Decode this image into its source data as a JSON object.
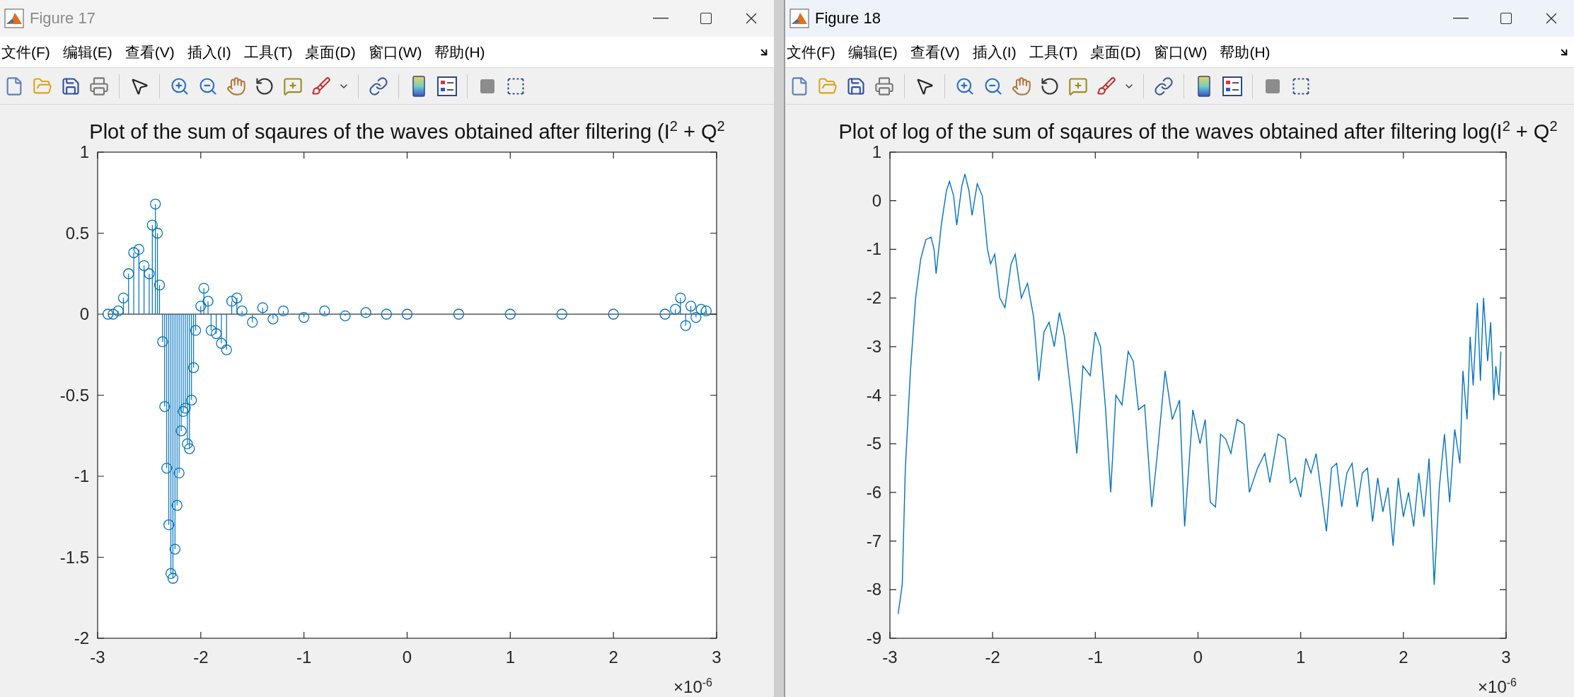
{
  "windows": [
    {
      "title": "Figure 17",
      "active": false,
      "menu": [
        "文件(F)",
        "编辑(E)",
        "查看(V)",
        "插入(I)",
        "工具(T)",
        "桌面(D)",
        "窗口(W)",
        "帮助(H)"
      ],
      "figure": {
        "exponent_label": "×10$^{-6}$",
        "chart_data": {
          "type": "scatter",
          "title": "Plot of the sum of sqaures of the waves obtained after filtering (I$^{2}$ + Q$^{2}$",
          "xlim": [
            -3,
            3
          ],
          "ylim": [
            -2,
            1
          ],
          "xticks": [
            -3,
            -2,
            -1,
            0,
            1,
            2,
            3
          ],
          "yticks": [
            -2,
            -1.5,
            -1,
            -0.5,
            0,
            0.5,
            1
          ],
          "x": [
            -2.9,
            -2.85,
            -2.8,
            -2.75,
            -2.7,
            -2.65,
            -2.6,
            -2.55,
            -2.5,
            -2.47,
            -2.44,
            -2.42,
            -2.4,
            -2.37,
            -2.35,
            -2.33,
            -2.31,
            -2.29,
            -2.27,
            -2.25,
            -2.23,
            -2.21,
            -2.19,
            -2.17,
            -2.15,
            -2.13,
            -2.11,
            -2.09,
            -2.07,
            -2.05,
            -2.0,
            -1.97,
            -1.93,
            -1.9,
            -1.85,
            -1.8,
            -1.75,
            -1.7,
            -1.65,
            -1.6,
            -1.5,
            -1.4,
            -1.3,
            -1.2,
            -1.0,
            -0.8,
            -0.6,
            -0.4,
            -0.2,
            0,
            0.5,
            1,
            1.5,
            2,
            2.5,
            2.6,
            2.65,
            2.7,
            2.75,
            2.8,
            2.85,
            2.9
          ],
          "series": [
            {
              "color": "#0072bd",
              "values": [
                0,
                0,
                0.02,
                0.1,
                0.25,
                0.38,
                0.4,
                0.3,
                0.25,
                0.55,
                0.68,
                0.5,
                0.18,
                -0.17,
                -0.57,
                -0.95,
                -1.3,
                -1.6,
                -1.63,
                -1.45,
                -1.18,
                -0.98,
                -0.72,
                -0.6,
                -0.58,
                -0.8,
                -0.83,
                -0.53,
                -0.33,
                -0.1,
                0.05,
                0.16,
                0.08,
                -0.1,
                -0.12,
                -0.18,
                -0.22,
                0.08,
                0.1,
                0.02,
                -0.05,
                0.04,
                -0.03,
                0.02,
                -0.02,
                0.02,
                -0.01,
                0.01,
                0,
                0,
                0,
                0,
                0,
                0,
                0,
                0.03,
                0.1,
                -0.07,
                0.05,
                -0.02,
                0.03,
                0.02
              ]
            }
          ]
        }
      }
    },
    {
      "title": "Figure 18",
      "active": true,
      "menu": [
        "文件(F)",
        "编辑(E)",
        "查看(V)",
        "插入(I)",
        "工具(T)",
        "桌面(D)",
        "窗口(W)",
        "帮助(H)"
      ],
      "figure": {
        "exponent_label": "×10$^{-6}$",
        "chart_data": {
          "type": "line",
          "title": "Plot of log of the sum of sqaures of the waves obtained after filtering log(I$^{2}$ + Q$^{2}$",
          "xlim": [
            -3,
            3
          ],
          "ylim": [
            -9,
            1
          ],
          "xticks": [
            -3,
            -2,
            -1,
            0,
            1,
            2,
            3
          ],
          "yticks": [
            -9,
            -8,
            -7,
            -6,
            -5,
            -4,
            -3,
            -2,
            -1,
            0,
            1
          ],
          "x": [
            -2.92,
            -2.88,
            -2.85,
            -2.8,
            -2.75,
            -2.7,
            -2.65,
            -2.6,
            -2.57,
            -2.55,
            -2.5,
            -2.45,
            -2.42,
            -2.38,
            -2.35,
            -2.3,
            -2.27,
            -2.23,
            -2.2,
            -2.15,
            -2.1,
            -2.05,
            -2.02,
            -1.98,
            -1.93,
            -1.88,
            -1.82,
            -1.78,
            -1.72,
            -1.66,
            -1.6,
            -1.55,
            -1.5,
            -1.45,
            -1.4,
            -1.35,
            -1.3,
            -1.22,
            -1.18,
            -1.12,
            -1.05,
            -1.0,
            -0.95,
            -0.9,
            -0.85,
            -0.8,
            -0.74,
            -0.68,
            -0.63,
            -0.58,
            -0.52,
            -0.45,
            -0.4,
            -0.32,
            -0.25,
            -0.18,
            -0.13,
            -0.05,
            0.02,
            0.07,
            0.12,
            0.17,
            0.22,
            0.27,
            0.32,
            0.38,
            0.45,
            0.5,
            0.58,
            0.65,
            0.7,
            0.78,
            0.85,
            0.9,
            0.95,
            1.0,
            1.05,
            1.1,
            1.15,
            1.2,
            1.25,
            1.3,
            1.35,
            1.4,
            1.45,
            1.5,
            1.55,
            1.6,
            1.65,
            1.7,
            1.75,
            1.8,
            1.85,
            1.9,
            1.95,
            2.0,
            2.05,
            2.1,
            2.15,
            2.2,
            2.25,
            2.3,
            2.35,
            2.4,
            2.45,
            2.5,
            2.55,
            2.58,
            2.62,
            2.65,
            2.68,
            2.72,
            2.75,
            2.78,
            2.82,
            2.85,
            2.88,
            2.9,
            2.93,
            2.95
          ],
          "series": [
            {
              "color": "#0072bd",
              "values": [
                -8.5,
                -7.9,
                -5.5,
                -3.5,
                -2.0,
                -1.2,
                -0.8,
                -0.75,
                -1.0,
                -1.5,
                -0.5,
                0.2,
                0.4,
                0.1,
                -0.5,
                0.3,
                0.55,
                0.2,
                -0.3,
                0.35,
                0.1,
                -1.0,
                -1.3,
                -1.1,
                -2.0,
                -2.2,
                -1.3,
                -1.1,
                -2.0,
                -1.7,
                -2.4,
                -3.7,
                -2.7,
                -2.5,
                -3.0,
                -2.3,
                -2.8,
                -4.3,
                -5.2,
                -3.4,
                -3.6,
                -2.7,
                -3.0,
                -4.3,
                -6.0,
                -4.0,
                -4.2,
                -3.1,
                -3.3,
                -4.3,
                -4.2,
                -6.3,
                -5.3,
                -3.5,
                -4.5,
                -4.1,
                -6.7,
                -4.3,
                -5.0,
                -4.5,
                -6.2,
                -6.3,
                -4.8,
                -4.9,
                -5.2,
                -4.5,
                -4.6,
                -6.0,
                -5.5,
                -5.2,
                -5.8,
                -4.8,
                -4.9,
                -5.8,
                -5.7,
                -6.1,
                -5.3,
                -5.6,
                -5.2,
                -6.0,
                -6.8,
                -5.5,
                -5.4,
                -6.3,
                -5.6,
                -5.4,
                -6.3,
                -5.6,
                -5.5,
                -6.6,
                -5.7,
                -6.4,
                -5.9,
                -7.1,
                -5.7,
                -6.5,
                -6.0,
                -6.7,
                -5.6,
                -6.5,
                -5.3,
                -7.9,
                -5.9,
                -4.8,
                -6.2,
                -4.7,
                -5.4,
                -3.5,
                -4.5,
                -2.8,
                -3.8,
                -2.1,
                -3.7,
                -2.0,
                -3.3,
                -2.5,
                -4.1,
                -3.4,
                -4.0,
                -3.1
              ]
            }
          ]
        }
      }
    }
  ]
}
